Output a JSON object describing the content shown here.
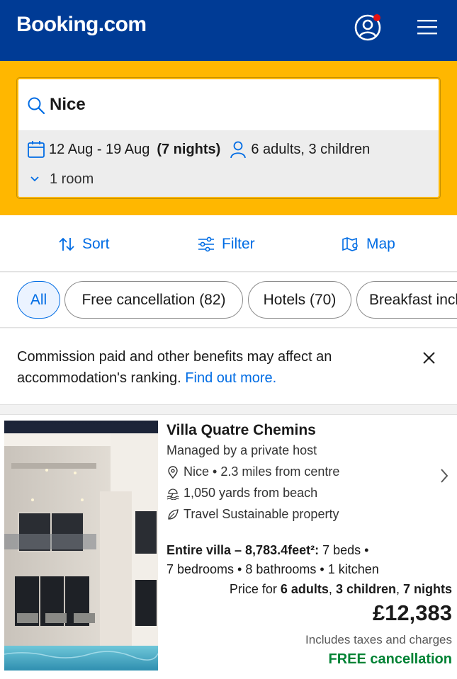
{
  "header": {
    "logo": "Booking.com",
    "account_notification": true
  },
  "search": {
    "destination": "Nice",
    "dates": "12 Aug - 19 Aug",
    "nights": "(7 nights)",
    "guests": "6 adults, 3 children",
    "rooms": "1 room"
  },
  "toolbar": {
    "sort": "Sort",
    "filter": "Filter",
    "map": "Map"
  },
  "chips": [
    "All",
    "Free cancellation (82)",
    "Hotels (70)",
    "Breakfast included"
  ],
  "notice": {
    "text": "Commission paid and other benefits may affect an accommodation's ranking.",
    "link": "Find out more."
  },
  "listing": {
    "name": "Villa Quatre Chemins",
    "host": "Managed by a private host",
    "location": "Nice • 2.3 miles from centre",
    "beach": "1,050 yards from beach",
    "sustainable": "Travel Sustainable property",
    "type": "Entire villa – 8,783.4feet²:",
    "beds": "7 beds •",
    "rooms_line": "7 bedrooms • 8 bathrooms • 1 kitchen",
    "price_for_label": "Price for",
    "price_for_adults": "6 adults",
    "price_for_children": "3 children",
    "price_for_nights": "7 nights",
    "price": "£12,383",
    "taxes": "Includes taxes and charges",
    "free_cancellation": "FREE cancellation"
  },
  "colors": {
    "brand": "#003b95",
    "accent": "#006ce4",
    "search_frame": "#ffb700",
    "success": "#008234"
  }
}
